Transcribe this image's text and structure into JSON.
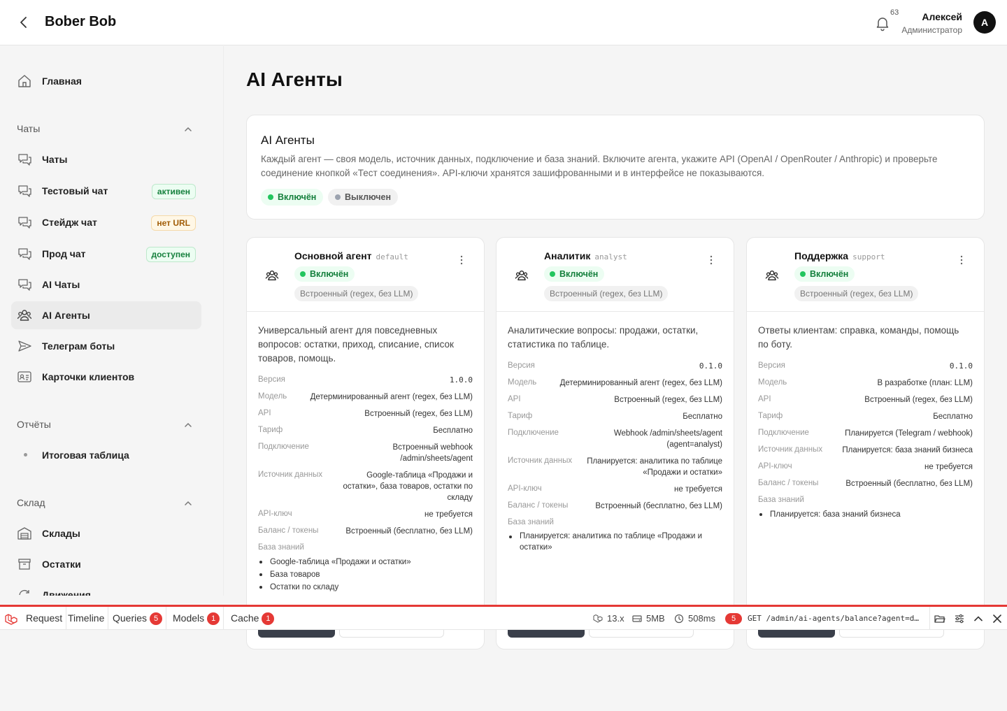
{
  "header": {
    "title": "Bober Bob",
    "notifications_count": "63",
    "user_name": "Алексей",
    "user_role": "Администратор",
    "avatar_letter": "A"
  },
  "sidebar": {
    "home": "Главная",
    "sections": {
      "chats": "Чаты",
      "reports": "Отчёты",
      "warehouse": "Склад"
    },
    "items": {
      "chats": "Чаты",
      "test_chat": "Тестовый чат",
      "test_chat_badge": "активен",
      "stage_chat": "Стейдж чат",
      "stage_chat_badge": "нет URL",
      "prod_chat": "Прод чат",
      "prod_chat_badge": "доступен",
      "ai_chats": "AI Чаты",
      "ai_agents": "AI Агенты",
      "telegram_bots": "Телеграм боты",
      "client_cards": "Карточки клиентов",
      "summary_table": "Итоговая таблица",
      "warehouses": "Склады",
      "stock": "Остатки",
      "movements": "Движения"
    }
  },
  "main": {
    "page_title": "AI Агенты",
    "intro": {
      "title": "AI Агенты",
      "description": "Каждый агент — своя модель, источник данных, подключение и база знаний. Включите агента, укажите API (OpenAI / OpenRouter / Anthropic) и проверьте соединение кнопкой «Тест соединения». API-ключи хранятся зашифрованными и в интерфейсе не показываются.",
      "legend_on": "Включён",
      "legend_off": "Выключен"
    },
    "labels": {
      "version": "Версия",
      "model": "Модель",
      "api": "API",
      "tariff": "Тариф",
      "connection": "Подключение",
      "data_source": "Источник данных",
      "api_key": "API-ключ",
      "balance": "Баланс / токены",
      "knowledge_base": "База знаний"
    },
    "agents": [
      {
        "name": "Основной агент",
        "code": "default",
        "status": "Включён",
        "engine": "Встроенный (regex, без LLM)",
        "description": "Универсальный агент для повседневных вопросов: остатки, приход, списание, список товаров, помощь.",
        "version": "1.0.0",
        "model": "Детерминированный агент (regex, без LLM)",
        "api": "Встроенный (regex, без LLM)",
        "tariff": "Бесплатно",
        "connection": "Встроенный webhook /admin/sheets/agent",
        "data_source": "Google-таблица «Продажи и остатки», база товаров, остатки по складу",
        "api_key": "не требуется",
        "balance": "Встроенный (бесплатно, без LLM)",
        "kb": [
          "Google-таблица «Продажи и остатки»",
          "База товаров",
          "Остатки по складу"
        ]
      },
      {
        "name": "Аналитик",
        "code": "analyst",
        "status": "Включён",
        "engine": "Встроенный (regex, без LLM)",
        "description": "Аналитические вопросы: продажи, остатки, статистика по таблице.",
        "version": "0.1.0",
        "model": "Детерминированный агент (regex, без LLM)",
        "api": "Встроенный (regex, без LLM)",
        "tariff": "Бесплатно",
        "connection": "Webhook /admin/sheets/agent (agent=analyst)",
        "data_source": "Планируется: аналитика по таблице «Продажи и остатки»",
        "api_key": "не требуется",
        "balance": "Встроенный (бесплатно, без LLM)",
        "kb": [
          "Планируется: аналитика по таблице «Продажи и остатки»"
        ]
      },
      {
        "name": "Поддержка",
        "code": "support",
        "status": "Включён",
        "engine": "Встроенный (regex, без LLM)",
        "description": "Ответы клиентам: справка, команды, помощь по боту.",
        "version": "0.1.0",
        "model": "В разработке (план: LLM)",
        "api": "Встроенный (regex, без LLM)",
        "tariff": "Бесплатно",
        "connection": "Планируется (Telegram / webhook)",
        "data_source": "Планируется: база знаний бизнеса",
        "api_key": "не требуется",
        "balance": "Встроенный (бесплатно, без LLM)",
        "kb": [
          "Планируется: база знаний бизнеса"
        ]
      }
    ]
  },
  "debugbar": {
    "tabs": {
      "request": "Request",
      "timeline": "Timeline",
      "queries": "Queries",
      "queries_count": "5",
      "models": "Models",
      "models_count": "1",
      "cache": "Cache",
      "cache_count": "1"
    },
    "php_version": "13.x",
    "memory": "5MB",
    "time": "508ms",
    "request_count": "5",
    "request_url": "GET /admin/ai-agents/balance?agent=d..."
  },
  "colors": {
    "accent_red": "#e53935",
    "status_green": "#22c55e",
    "dark_button": "#3a3f4a"
  }
}
